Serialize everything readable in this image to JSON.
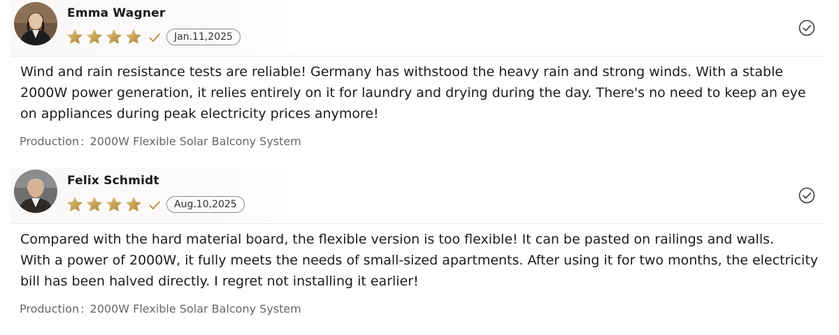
{
  "reviews": [
    {
      "name": "Emma Wagner",
      "avatar_icon": "woman-portrait-avatar",
      "rating": 4,
      "date": "Jan.11,2025",
      "text": "Wind and rain resistance tests are reliable! Germany has withstood the heavy rain and strong winds. With a stable 2000W power generation, it relies entirely on it for laundry and drying during the day. There's no need to keep an eye on appliances during peak electricity prices anymore!",
      "product_label": "Production",
      "product_separator": ":",
      "product_name": "2000W Flexible Solar Balcony System"
    },
    {
      "name": "Felix Schmidt",
      "avatar_icon": "man-portrait-avatar",
      "rating": 4,
      "date": "Aug.10,2025",
      "text": "Compared with the hard material board, the flexible version is too flexible! It can be pasted on railings and walls.\nWith a power of 2000W, it fully meets the needs of small-sized apartments. After using it for two months, the electricity bill has been halved directly. I regret not installing it earlier!",
      "product_label": "Production",
      "product_separator": ":",
      "product_name": "2000W Flexible Solar Balcony System"
    }
  ],
  "colors": {
    "star_gold": "#c9a04a",
    "star_gold_light": "#e7c987",
    "check_gold": "#b08d3c",
    "badge_border": "#8a8a8a",
    "divider": "#e6e6e6",
    "product_text": "#666666"
  },
  "icons": {
    "star": "star-icon",
    "verified": "verified-check-icon",
    "select": "circle-check-icon"
  }
}
